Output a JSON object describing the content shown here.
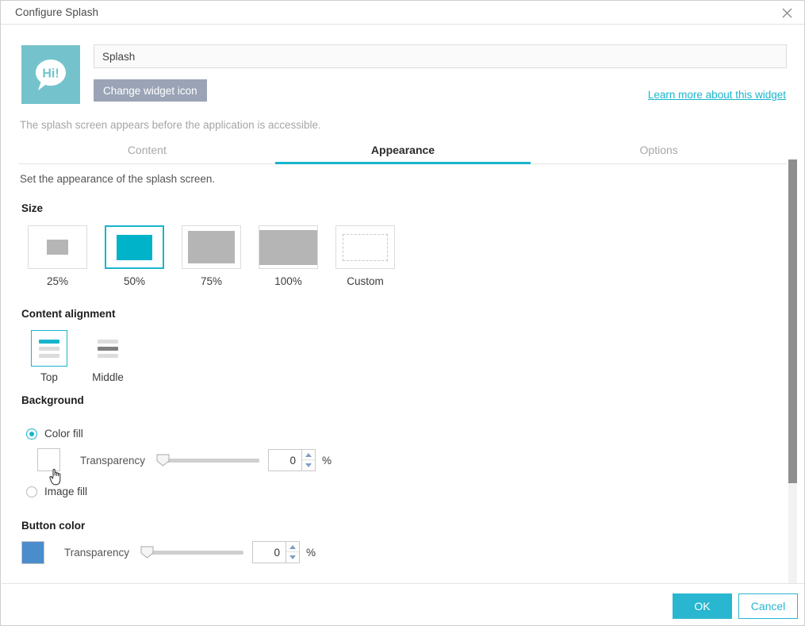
{
  "window": {
    "title": "Configure Splash",
    "close_icon": "close-icon"
  },
  "header": {
    "widget_icon_name": "speech-bubble-hi-icon",
    "widget_icon_text": "Hi!",
    "widget_icon_bg": "#74c3cc",
    "name_value": "Splash",
    "name_placeholder": "Splash",
    "change_icon_label": "Change widget icon",
    "learn_more_label": "Learn more about this widget",
    "description": "The splash screen appears before the application is accessible."
  },
  "tabs": [
    {
      "label": "Content",
      "active": false
    },
    {
      "label": "Appearance",
      "active": true
    },
    {
      "label": "Options",
      "active": false
    }
  ],
  "main": {
    "intro": "Set the appearance of the splash screen.",
    "size": {
      "title": "Size",
      "options": [
        {
          "label": "25%",
          "selected": false
        },
        {
          "label": "50%",
          "selected": true
        },
        {
          "label": "75%",
          "selected": false
        },
        {
          "label": "100%",
          "selected": false
        },
        {
          "label": "Custom",
          "selected": false
        }
      ]
    },
    "content_alignment": {
      "title": "Content alignment",
      "options": [
        {
          "label": "Top",
          "selected": true
        },
        {
          "label": "Middle",
          "selected": false
        }
      ]
    },
    "background": {
      "title": "Background",
      "color_fill_label": "Color fill",
      "color_fill_selected": true,
      "image_fill_label": "Image fill",
      "image_fill_selected": false,
      "swatch_color": "#ffffff",
      "transparency_label": "Transparency",
      "transparency_value": "0",
      "percent_symbol": "%"
    },
    "button_color": {
      "title": "Button color",
      "swatch_color": "#4a8ccc",
      "transparency_label": "Transparency",
      "transparency_value": "0",
      "percent_symbol": "%"
    }
  },
  "footer": {
    "ok_label": "OK",
    "cancel_label": "Cancel"
  },
  "theme": {
    "accent": "#19b5cc",
    "ok_button": "#29b6d0",
    "size_selected_fill": "#00b3c8",
    "change_icon_button": "#9aa4b6"
  },
  "cursor": {
    "type": "pointer-hand-cursor"
  }
}
